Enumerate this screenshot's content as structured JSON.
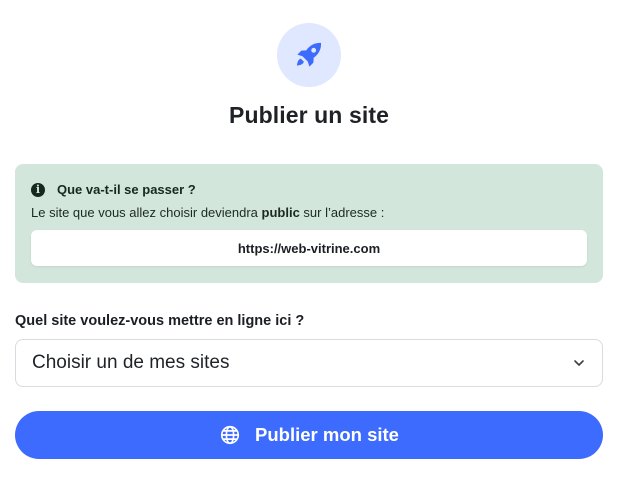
{
  "header": {
    "icon": "rocket-icon",
    "title": "Publier un site"
  },
  "info": {
    "icon": "info-icon",
    "heading": "Que va-t-il se passer ?",
    "text_before": "Le site que vous allez choisir deviendra ",
    "text_bold": "public",
    "text_after": " sur l’adresse :",
    "url": "https://web-vitrine.com",
    "background_color": "#d2e6dc"
  },
  "site_select": {
    "question": "Quel site voulez-vous mettre en ligne ici ?",
    "selected_value": "Choisir un de mes sites",
    "icon": "chevron-down-icon"
  },
  "publish_button": {
    "label": "Publier mon site",
    "icon": "globe-icon",
    "color": "#3d6bfd"
  }
}
